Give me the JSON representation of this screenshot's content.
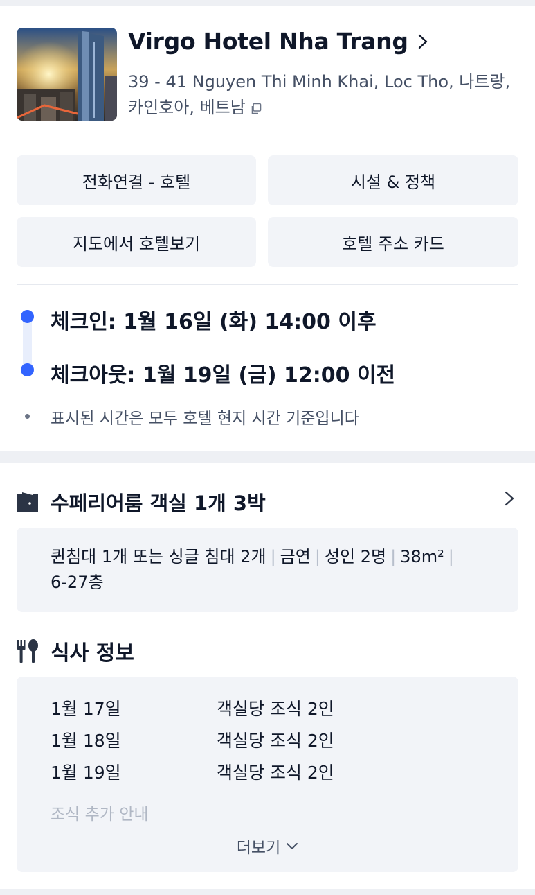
{
  "hotel": {
    "name": "Virgo Hotel Nha Trang",
    "address": "39 - 41 Nguyen Thi Minh Khai, Loc Tho, 나트랑, 카인호아, 베트남"
  },
  "actions": {
    "call": "전화연결 - 호텔",
    "facilities": "시설 & 정책",
    "map": "지도에서 호텔보기",
    "address_card": "호텔 주소 카드"
  },
  "stay": {
    "checkin": "체크인: 1월 16일 (화) 14:00 이후",
    "checkout": "체크아웃: 1월 19일 (금) 12:00 이전",
    "note": "표시된 시간은 모두 호텔 현지 시간 기준입니다"
  },
  "room": {
    "title": "수페리어룸  객실 1개 3박",
    "features": [
      "퀸침대 1개 또는 싱글 침대 2개",
      "금연",
      "성인 2명",
      "38m²",
      "6-27층"
    ]
  },
  "meal": {
    "title": "식사 정보",
    "rows": [
      {
        "date": "1월 17일",
        "desc": "객실당 조식 2인"
      },
      {
        "date": "1월 18일",
        "desc": "객실당 조식 2인"
      },
      {
        "date": "1월 19일",
        "desc": "객실당 조식 2인"
      }
    ],
    "extra": "조식 추가 안내",
    "more": "더보기"
  },
  "colors": {
    "accent": "#3264ff",
    "panel": "#f2f4f8",
    "text": "#0f1729",
    "secondary": "#455065"
  },
  "icons": [
    "chevron-right-icon",
    "copy-icon",
    "door-icon",
    "utensils-icon",
    "chevron-down-icon"
  ]
}
